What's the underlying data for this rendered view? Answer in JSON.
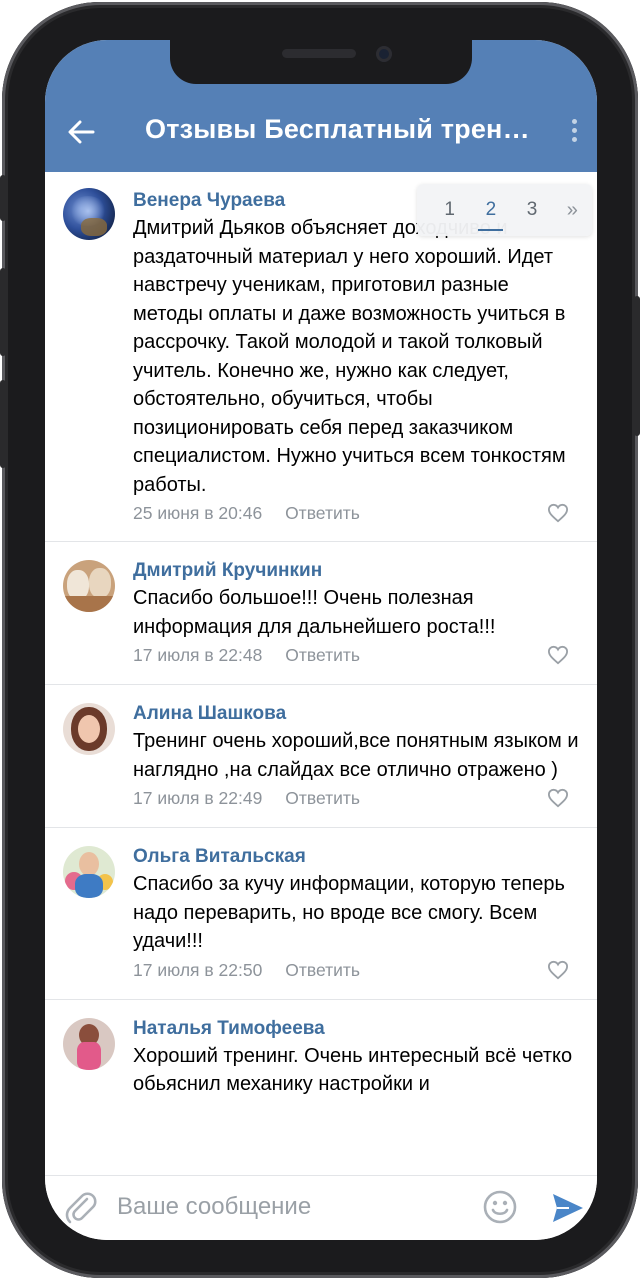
{
  "header": {
    "title": "Отзывы Бесплатный тренинг"
  },
  "pagination": {
    "pages": [
      "1",
      "2",
      "3"
    ],
    "active": "2",
    "next": "»"
  },
  "comments": [
    {
      "author": "Венера Чураева",
      "text": "Дмитрий Дьяков объясняет доходчиво и раздаточный материал у него хороший. Идет навстречу ученикам, приготовил разные методы оплаты и даже возможность учиться в рассрочку. Такой молодой и такой толковый учитель. Конечно же, нужно как следует, обстоятельно, обучиться, чтобы позиционировать себя перед заказчиком специалистом. Нужно учиться всем тонкостям работы.",
      "date": "25 июня в 20:46",
      "reply": "Ответить"
    },
    {
      "author": "Дмитрий Кручинкин",
      "text": "Спасибо большое!!! Очень полезная информация для дальнейшего роста!!!",
      "date": "17 июля в 22:48",
      "reply": "Ответить"
    },
    {
      "author": "Алина Шашкова",
      "text": "Тренинг очень хороший,все понятным языком и наглядно ,на слайдах все отлично отражено )",
      "date": "17 июля в 22:49",
      "reply": "Ответить"
    },
    {
      "author": "Ольга Витальская",
      "text": "Спасибо за кучу информации, которую теперь надо переварить, но вроде все смогу. Всем удачи!!!",
      "date": "17 июля в 22:50",
      "reply": "Ответить"
    },
    {
      "author": "Наталья Тимофеева",
      "text": "Хороший тренинг. Очень интересный  всё четко обьяснил механику настройки и",
      "date": "",
      "reply": ""
    }
  ],
  "composer": {
    "placeholder": "Ваше сообщение"
  },
  "colors": {
    "header": "#5580b6",
    "name": "#3f6e9e",
    "meta": "#8d939a",
    "send": "#4a86c8"
  },
  "icons": [
    "back-arrow-icon",
    "more-vertical-icon",
    "heart-icon",
    "paperclip-icon",
    "smile-icon",
    "send-icon"
  ]
}
